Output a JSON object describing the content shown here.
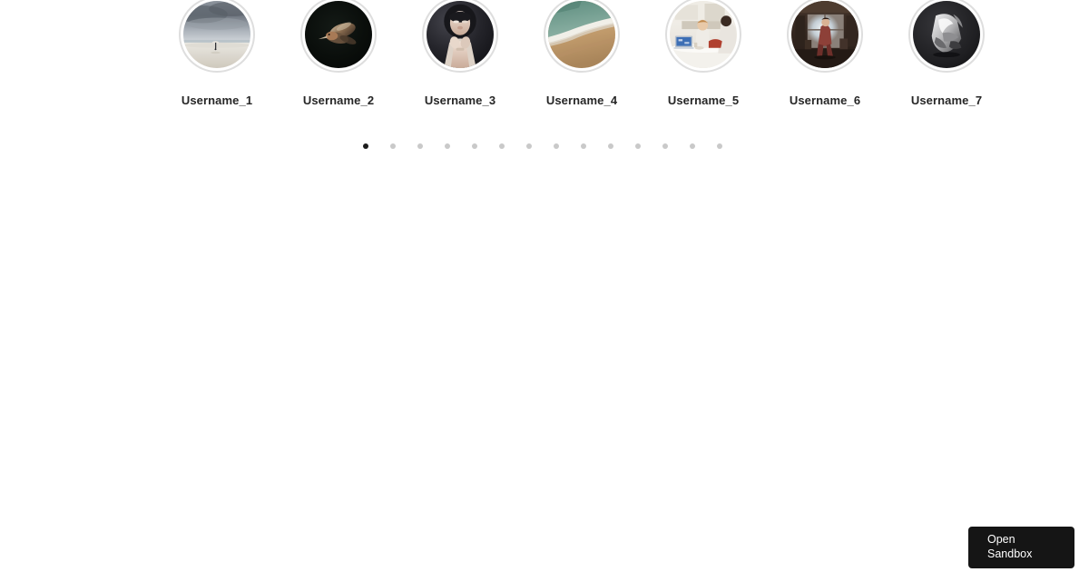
{
  "page": {
    "background_color": "#ffffff",
    "title": "Stories Carousel"
  },
  "carousel": {
    "ring_color": "#dedede",
    "label_color": "#262626",
    "slides": [
      {
        "username": "Username_1",
        "avatar_name": "avatar-beach-storm-figure",
        "avatar_description": "Lone figure with umbrella on a pale salt flat under dark storm clouds",
        "colors": [
          "#6f7680",
          "#9aa2ab",
          "#c8cdd2",
          "#e8e6e0",
          "#cfc9bd"
        ]
      },
      {
        "username": "Username_2",
        "avatar_name": "avatar-bird-dark",
        "avatar_description": "Kingfisher bird in flight against a near-black background",
        "colors": [
          "#080b09",
          "#121613",
          "#8a6a52",
          "#b89a7c",
          "#d8cbb8"
        ]
      },
      {
        "username": "Username_3",
        "avatar_name": "avatar-portrait-woman",
        "avatar_description": "Portrait of a woman with dark hair and pale skin on a dark backdrop",
        "colors": [
          "#1a1a1e",
          "#34343a",
          "#d8c4b8",
          "#efe2d8",
          "#c3aa9c"
        ]
      },
      {
        "username": "Username_4",
        "avatar_name": "avatar-shoreline-aerial",
        "avatar_description": "Aerial shoreline with teal water, white surf and tan sand",
        "colors": [
          "#6f9a8c",
          "#9dbcb0",
          "#f0efe9",
          "#c8a57a",
          "#b08f63"
        ]
      },
      {
        "username": "Username_5",
        "avatar_name": "avatar-kitchen-child-laptop",
        "avatar_description": "Bright kitchen interior with a child and a laptop on a white counter",
        "colors": [
          "#f2efe9",
          "#dcd6cc",
          "#b6beca",
          "#3d6fb5",
          "#a8512f"
        ]
      },
      {
        "username": "Username_6",
        "avatar_name": "avatar-interior-window-light",
        "avatar_description": "Dim warm interior with a figure standing near a bright window",
        "colors": [
          "#2b211c",
          "#5b463a",
          "#cfd6dc",
          "#8c6b55",
          "#7a2f2a"
        ]
      },
      {
        "username": "Username_7",
        "avatar_name": "avatar-abstract-sculpture-bw",
        "avatar_description": "Black and white abstract sculptural form on a dark gray backdrop",
        "colors": [
          "#1e1e20",
          "#2e2e31",
          "#d6d6d6",
          "#8e8e90",
          "#f2f2f2"
        ]
      }
    ]
  },
  "pagination": {
    "total": 14,
    "active_index": 0,
    "active_color": "#1c1c1c",
    "inactive_color": "#c9c9c9"
  },
  "sandbox_badge": {
    "line1": "Open",
    "line2": "Sandbox",
    "background_color": "#151515",
    "text_color": "#ffffff"
  }
}
